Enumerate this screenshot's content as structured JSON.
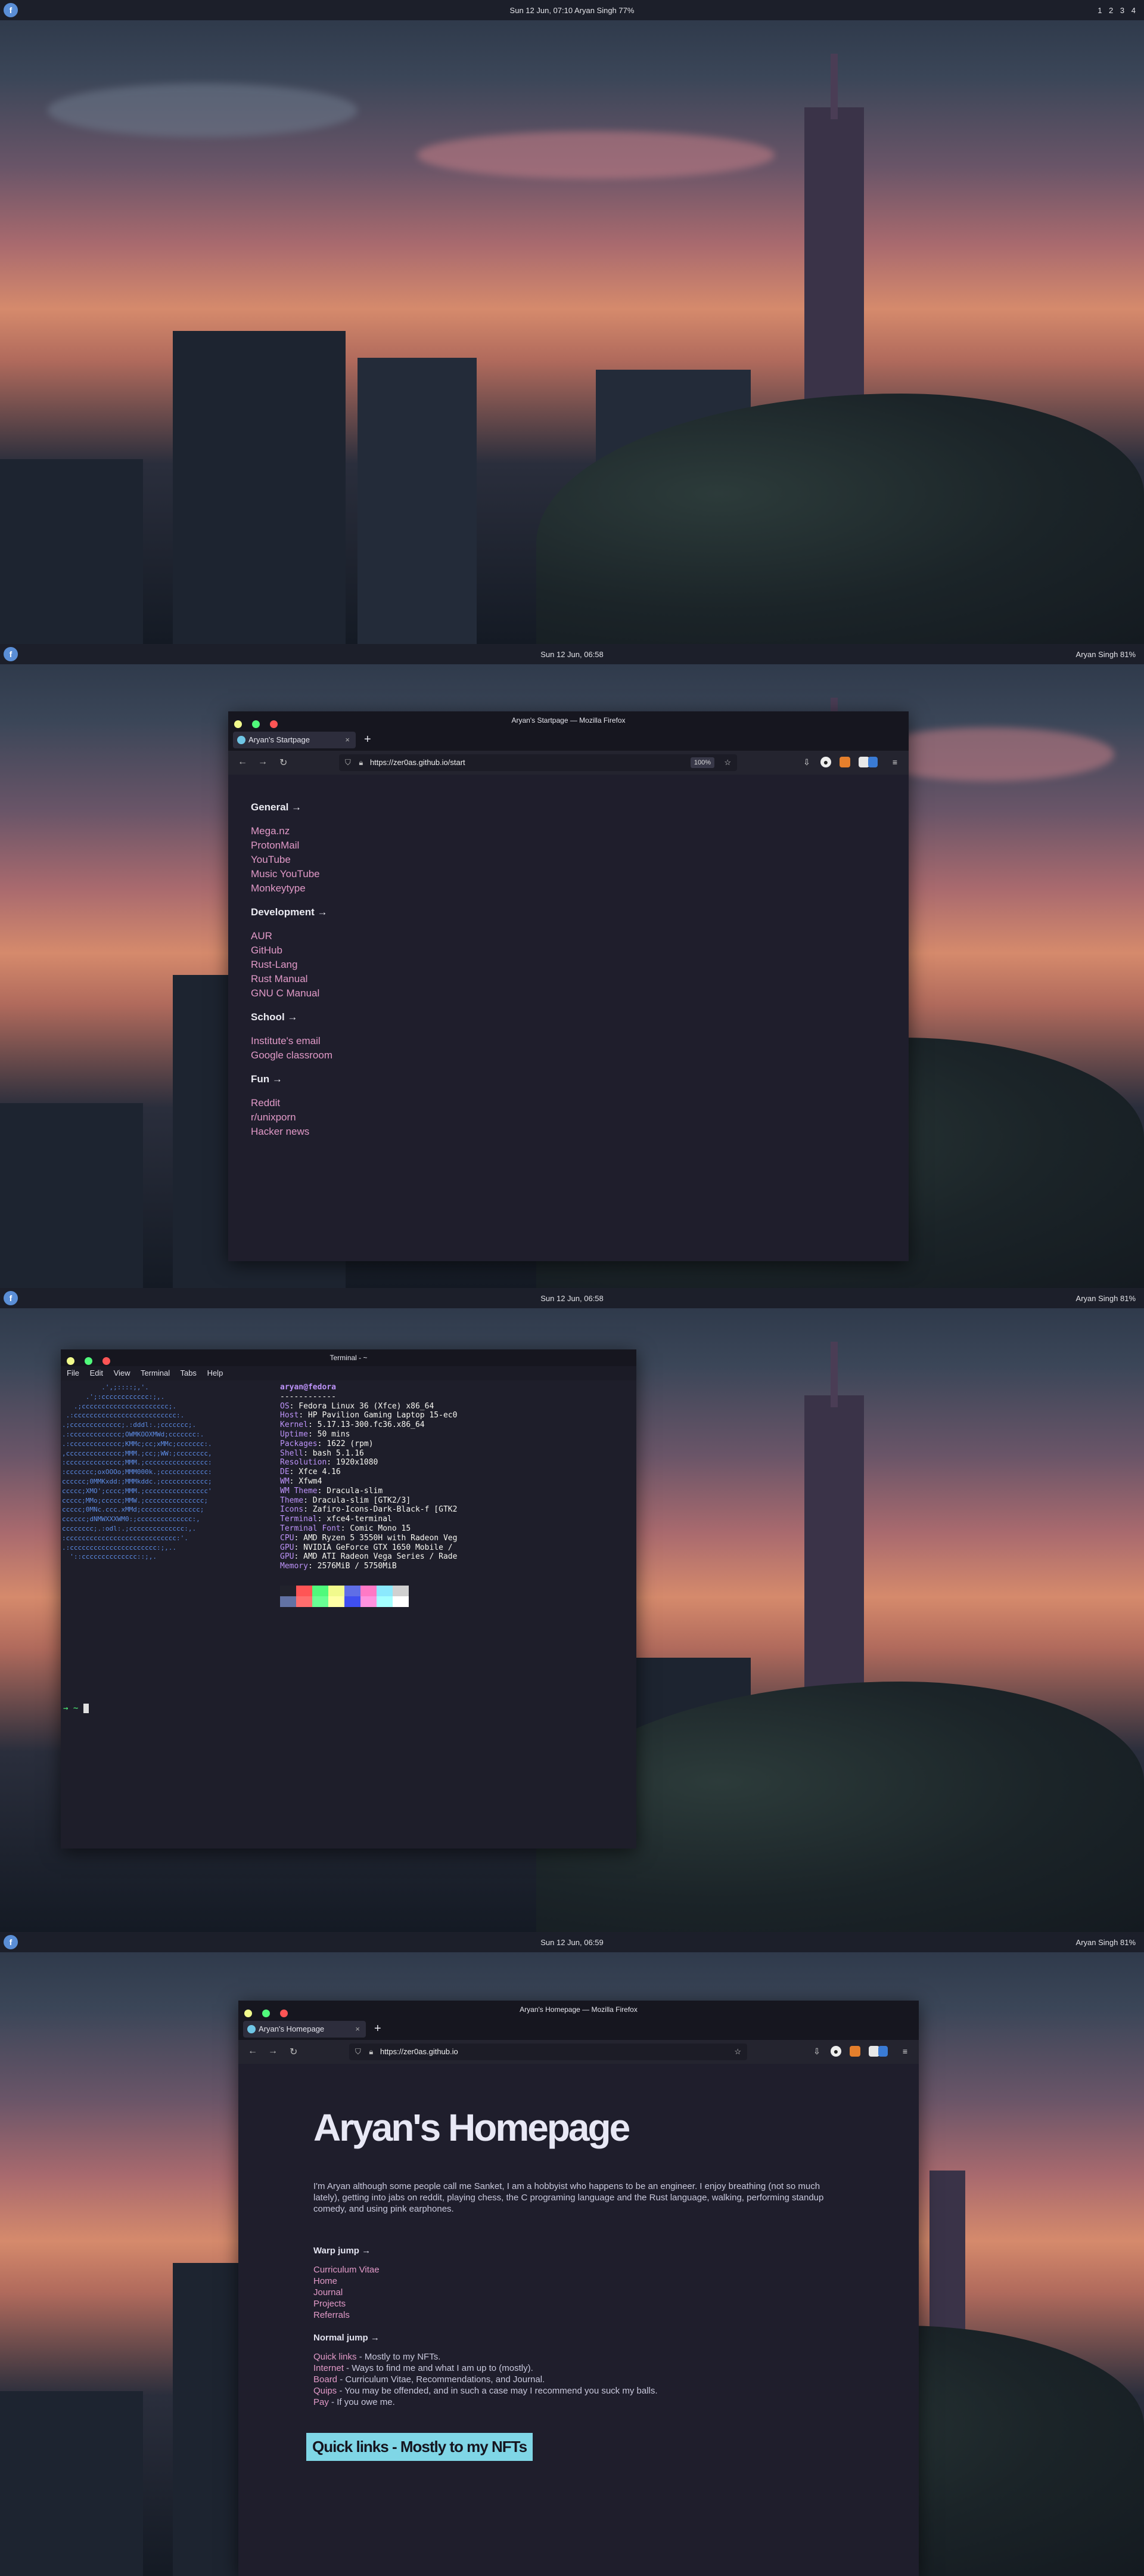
{
  "screens": [
    {
      "bar": {
        "dock_icon": "fedora-icon",
        "center": "Sun 12 Jun, 07:10  Aryan Singh  77%",
        "workspaces": [
          "1",
          "2",
          "3",
          "4"
        ]
      }
    },
    {
      "bar": {
        "dock_icon": "fedora-icon",
        "center": "Sun 12 Jun, 06:58",
        "right": "Aryan Singh  81%"
      },
      "window": {
        "title": "Aryan's Startpage — Mozilla Firefox",
        "tab": "Aryan's Startpage",
        "url": "https://zer0as.github.io/start",
        "zoom": "100%",
        "groups": [
          {
            "title": "General →",
            "links": [
              "Mega.nz",
              "ProtonMail",
              "YouTube",
              "Music YouTube",
              "Monkeytype"
            ]
          },
          {
            "title": "Development →",
            "links": [
              "AUR",
              "GitHub",
              "Rust-Lang",
              "Rust Manual",
              "GNU C Manual"
            ]
          },
          {
            "title": "School →",
            "links": [
              "Institute's email",
              "Google classroom"
            ]
          },
          {
            "title": "Fun →",
            "links": [
              "Reddit",
              "r/unixporn",
              "Hacker news"
            ]
          }
        ]
      }
    },
    {
      "bar": {
        "dock_icon": "fedora-icon",
        "center": "Sun 12 Jun, 06:58",
        "right": "Aryan Singh  81%"
      },
      "terminal": {
        "title": "Terminal - ~",
        "menu": [
          "File",
          "Edit",
          "View",
          "Terminal",
          "Tabs",
          "Help"
        ],
        "user": "aryan@fedora",
        "sep": "------------",
        "info": [
          [
            "OS",
            "Fedora Linux 36 (Xfce) x86_64"
          ],
          [
            "Host",
            "HP Pavilion Gaming Laptop 15-ec0"
          ],
          [
            "Kernel",
            "5.17.13-300.fc36.x86_64"
          ],
          [
            "Uptime",
            "50 mins"
          ],
          [
            "Packages",
            "1622 (rpm)"
          ],
          [
            "Shell",
            "bash 5.1.16"
          ],
          [
            "Resolution",
            "1920x1080"
          ],
          [
            "DE",
            "Xfce 4.16"
          ],
          [
            "WM",
            "Xfwm4"
          ],
          [
            "WM Theme",
            "Dracula-slim"
          ],
          [
            "Theme",
            "Dracula-slim [GTK2/3]"
          ],
          [
            "Icons",
            "Zafiro-Icons-Dark-Black-f [GTK2"
          ],
          [
            "Terminal",
            "xfce4-terminal"
          ],
          [
            "Terminal Font",
            "Comic Mono 15"
          ],
          [
            "CPU",
            "AMD Ryzen 5 3550H with Radeon Veg"
          ],
          [
            "GPU",
            "NVIDIA GeForce GTX 1650 Mobile /"
          ],
          [
            "GPU",
            "AMD ATI Radeon Vega Series / Rade"
          ],
          [
            "Memory",
            "2576MiB / 5750MiB"
          ]
        ],
        "prompt": "→ ~ "
      }
    },
    {
      "bar": {
        "dock_icon": "fedora-icon",
        "center": "Sun 12 Jun, 06:59",
        "right": "Aryan Singh  81%"
      },
      "window": {
        "title": "Aryan's Homepage — Mozilla Firefox",
        "tab": "Aryan's Homepage",
        "url": "https://zer0as.github.io",
        "heading": "Aryan's Homepage",
        "intro": "I'm Aryan although some people call me Sanket, I am a hobbyist who happens to be an engineer. I enjoy breathing (not so much lately), getting into jabs on reddit, playing chess, the C programing language and the Rust language, walking, performing standup comedy, and using pink earphones.",
        "warp_title": "Warp jump →",
        "warp_links": [
          "Curriculum Vitae",
          "Home",
          "Journal",
          "Projects",
          "Referrals"
        ],
        "normal_title": "Normal jump →",
        "normal_links": [
          {
            "l": "Quick links",
            "d": " - Mostly to my NFTs."
          },
          {
            "l": "Internet",
            "d": " - Ways to find me and what I am up to (mostly)."
          },
          {
            "l": "Board",
            "d": " - Curriculum Vitae, Recommendations, and Journal."
          },
          {
            "l": "Quips",
            "d": " - You may be offended, and in such a case may I recommend you suck my balls."
          },
          {
            "l": "Pay",
            "d": " - If you owe me."
          }
        ],
        "quick_heading": "Quick links - Mostly to my NFTs"
      }
    }
  ],
  "colors": {
    "accent": "#e29ac8",
    "purple": "#bd93f9",
    "bg": "#1f1e2c"
  }
}
